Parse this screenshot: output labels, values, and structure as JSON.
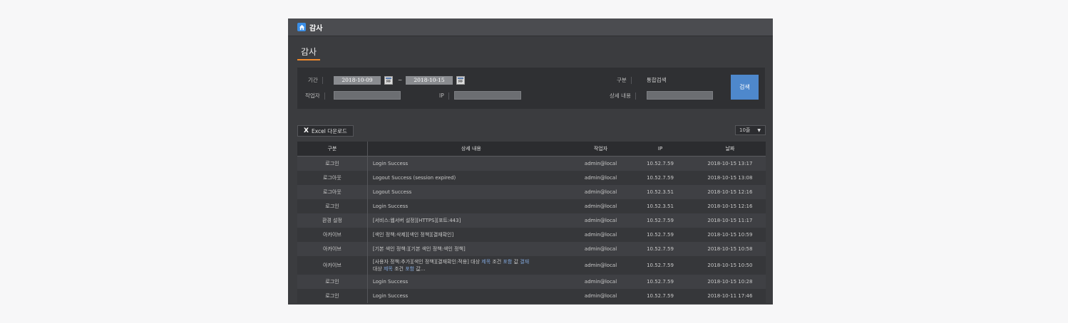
{
  "window": {
    "title": "감사"
  },
  "section": {
    "title": "감사"
  },
  "filters": {
    "period_label": "기간",
    "date_from": "2018-10-09",
    "date_separator": "~",
    "date_to": "2018-10-15",
    "category_label": "구분",
    "category_value": "통합검색",
    "author_label": "작업자",
    "ip_label": "IP",
    "detail_label": "상세 내용",
    "search_button": "검색"
  },
  "toolbar": {
    "excel_icon": "X",
    "excel_label": "Excel 다운로드",
    "rows_per_page": "10줄",
    "rows_caret": "▼"
  },
  "table": {
    "headers": [
      "구분",
      "상세 내용",
      "작업자",
      "IP",
      "날짜"
    ],
    "rows": [
      {
        "type": "로그인",
        "detail": "Login Success",
        "user": "admin@local",
        "ip": "10.52.7.59",
        "date": "2018-10-15 13:17"
      },
      {
        "type": "로그아웃",
        "detail": "Logout Success (session expired)",
        "user": "admin@local",
        "ip": "10.52.7.59",
        "date": "2018-10-15 13:08"
      },
      {
        "type": "로그아웃",
        "detail": "Logout Success",
        "user": "admin@local",
        "ip": "10.52.3.51",
        "date": "2018-10-15 12:16"
      },
      {
        "type": "로그인",
        "detail": "Login Success",
        "user": "admin@local",
        "ip": "10.52.3.51",
        "date": "2018-10-15 12:16"
      },
      {
        "type": "환경 설정",
        "detail": "[서비스:웹서버 설정][HTTPS][포트:443]",
        "user": "admin@local",
        "ip": "10.52.7.59",
        "date": "2018-10-15 11:17"
      },
      {
        "type": "아카이브",
        "detail": "[색인 정책:삭제][색인 정책][결재확인]",
        "user": "admin@local",
        "ip": "10.52.7.59",
        "date": "2018-10-15 10:59"
      },
      {
        "type": "아카이브",
        "detail": "[기본 색인 정책:][기본 색인 정책:색인 정책]",
        "user": "admin@local",
        "ip": "10.52.7.59",
        "date": "2018-10-15 10:58"
      },
      {
        "type": "아카이브",
        "detail_line1_a": "[사용자 정책:추가][색인 정책][결재확인:적용]  대상 ",
        "detail_line1_b": "제목",
        "detail_line1_c": "  조건 ",
        "detail_line1_d": "포함",
        "detail_line1_e": "  값 ",
        "detail_line1_f": "결재",
        "detail_line2_a": "대상 ",
        "detail_line2_b": "제목",
        "detail_line2_c": "  조건 ",
        "detail_line2_d": "포함",
        "detail_line2_e": "  값...",
        "user": "admin@local",
        "ip": "10.52.7.59",
        "date": "2018-10-15 10:50"
      },
      {
        "type": "로그인",
        "detail": "Login Success",
        "user": "admin@local",
        "ip": "10.52.7.59",
        "date": "2018-10-15 10:28"
      },
      {
        "type": "로그인",
        "detail": "Login Success",
        "user": "admin@local",
        "ip": "10.52.7.59",
        "date": "2018-10-11 17:46"
      }
    ]
  },
  "colors": {
    "accent_orange": "#f08a2c",
    "search_button_blue": "#4e88cc",
    "highlight_blue": "#7fa3d6"
  },
  "icons": [
    "home-icon",
    "calendar-icon",
    "excel-icon",
    "chevron-down-icon"
  ]
}
